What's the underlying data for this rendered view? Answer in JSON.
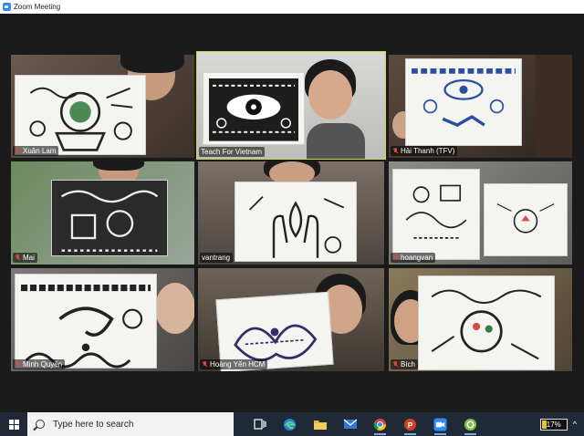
{
  "window": {
    "title": "Zoom Meeting"
  },
  "participants": [
    {
      "name": "Xuân Lam",
      "muted": true
    },
    {
      "name": "Teach For Vietnam",
      "muted": false,
      "active": true
    },
    {
      "name": "Hải Thanh (TFV)",
      "muted": true
    },
    {
      "name": "Mai",
      "muted": true
    },
    {
      "name": "vantrang",
      "muted": false
    },
    {
      "name": "hoangvan",
      "muted": true
    },
    {
      "name": "Minh Quyên",
      "muted": true
    },
    {
      "name": "Hoàng Yến HCM",
      "muted": true
    },
    {
      "name": "Bích",
      "muted": true
    }
  ],
  "taskbar": {
    "search_placeholder": "Type here to search",
    "apps": [
      "task-view-icon",
      "edge-icon",
      "file-explorer-icon",
      "mail-icon",
      "chrome-icon",
      "powerpoint-icon",
      "zoom-icon",
      "green-app-icon"
    ],
    "battery_percent": "17%",
    "battery_level": 0.17,
    "tray_caret": "^"
  },
  "colors": {
    "active_speaker": "#c8d94a",
    "mute": "#e0443a",
    "zoom_blue": "#2d8cff"
  }
}
